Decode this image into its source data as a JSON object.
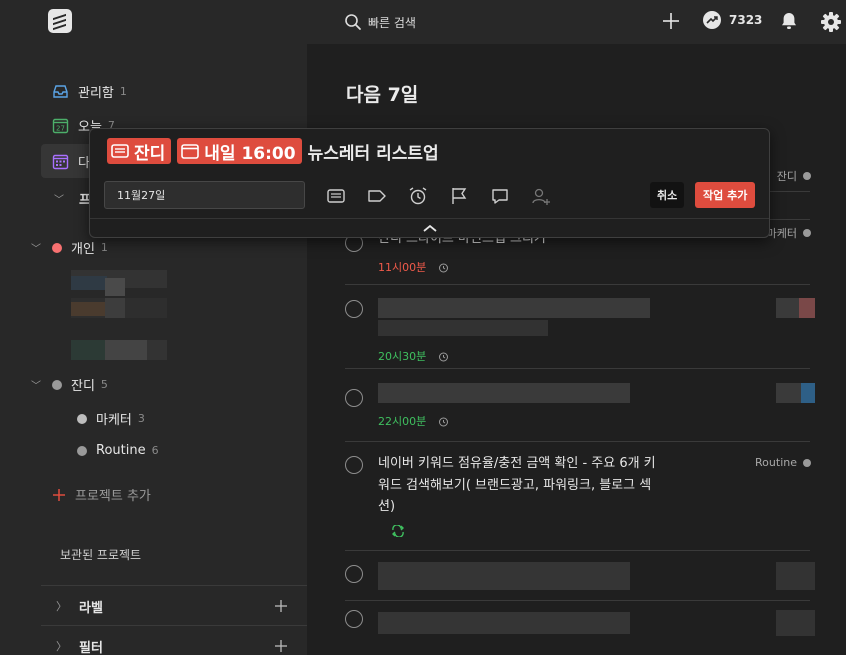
{
  "topbar": {
    "search_placeholder": "빠른 검색",
    "karma": "7323",
    "icons": [
      "logo-icon",
      "search-icon",
      "plus-icon",
      "karma-icon",
      "bell-icon",
      "gear-icon"
    ]
  },
  "sidebar": {
    "inbox": {
      "label": "관리함",
      "count": "1"
    },
    "today": {
      "label": "오늘",
      "count": "7",
      "icon_day": "27"
    },
    "upcoming": {
      "label": "다음 7일"
    },
    "projects_header": "프로젝트",
    "projects": [
      {
        "label": "개인",
        "count": "1",
        "color": "#f87171"
      },
      {
        "label": "잔디",
        "count": "5",
        "color": "#9a9a9a"
      },
      {
        "label": "마케터",
        "count": "3",
        "color": "#bdbdbd"
      },
      {
        "label": "Routine",
        "count": "6",
        "color": "#9a9a9a"
      }
    ],
    "add_project": "프로젝트 추가",
    "archived": "보관된 프로젝트",
    "labels": "라벨",
    "filters": "필터"
  },
  "main": {
    "title": "다음 7일",
    "tasks": [
      {
        "text": "",
        "project": "잔디"
      },
      {
        "text": "잔디 드라이브 마인드맵 그리기",
        "time": "11시00분",
        "time_color": "#ef5a4a",
        "project": "마케터"
      },
      {
        "text": "",
        "time": "20시30분",
        "time_color": "#3fbf5f"
      },
      {
        "text": "",
        "time": "22시00분",
        "time_color": "#3fbf5f"
      },
      {
        "text_lines": [
          "네이버 키워드 점유율/충전 금액 확인 - 주요 6개 키",
          "워드 검색해보기( 브랜드광고, 파워링크, 블로그 섹",
          "션)"
        ],
        "project": "Routine",
        "recurring": true
      },
      {
        "text": ""
      },
      {
        "text": ""
      }
    ]
  },
  "quick_add": {
    "chip_project": "잔디",
    "chip_date": "내일 16:00",
    "title": "뉴스레터 리스트업",
    "date_field": "11월27일",
    "tools": [
      "project-icon",
      "label-icon",
      "reminder-icon",
      "priority-flag-icon",
      "comment-icon",
      "assign-icon"
    ],
    "cancel": "취소",
    "add": "작업 추가"
  },
  "colors": {
    "accent": "#de4c3e",
    "green": "#3fbf5f",
    "red_time": "#ef5a4a"
  }
}
